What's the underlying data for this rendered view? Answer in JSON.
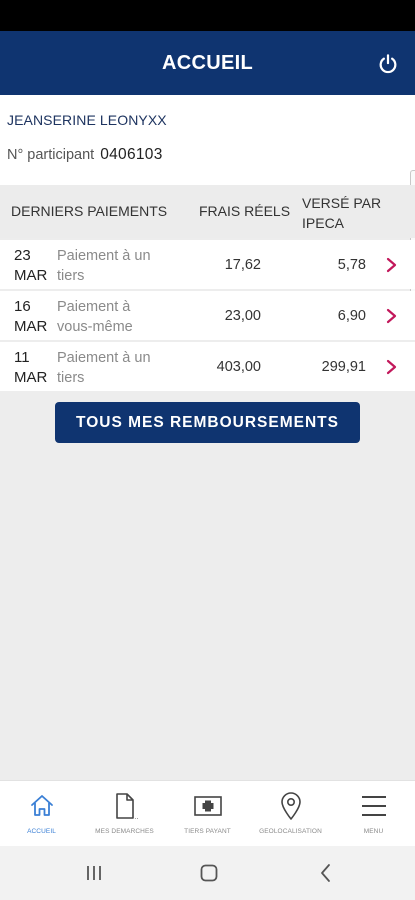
{
  "header": {
    "title": "ACCUEIL",
    "power_icon": "power-icon"
  },
  "user": {
    "name": "JEANSERINE LEONYXX",
    "participant_label": "N° participant",
    "participant_number": "0406103"
  },
  "table": {
    "columns": {
      "label": "DERNIERS PAIEMENTS",
      "frais": "FRAIS RÉELS",
      "verse_line1": "VERSÉ PAR",
      "verse_line2": "IPECA"
    },
    "rows": [
      {
        "day": "23",
        "month": "MAR",
        "label_line1": "Paiement à un",
        "label_line2": "tiers",
        "frais": "17,62",
        "verse": "5,78"
      },
      {
        "day": "16",
        "month": "MAR",
        "label_line1": "Paiement à",
        "label_line2": "vous-même",
        "frais": "23,00",
        "verse": "6,90"
      },
      {
        "day": "11",
        "month": "MAR",
        "label_line1": "Paiement à un",
        "label_line2": "tiers",
        "frais": "403,00",
        "verse": "299,91"
      }
    ]
  },
  "cta": {
    "label": "TOUS MES REMBOURSEMENTS"
  },
  "bottom_nav": [
    {
      "label": "ACCUEIL",
      "icon": "home-icon",
      "active": true
    },
    {
      "label": "MES DEMARCHES",
      "icon": "document-icon",
      "active": false
    },
    {
      "label": "TIERS PAYANT",
      "icon": "medical-card-icon",
      "active": false
    },
    {
      "label": "GEOLOCALISATION",
      "icon": "location-pin-icon",
      "active": false
    },
    {
      "label": "MENU",
      "icon": "hamburger-menu-icon",
      "active": false
    }
  ],
  "colors": {
    "brand_navy": "#0f3470",
    "chevron_red": "#c2185b",
    "active_blue": "#3a7fd5"
  }
}
